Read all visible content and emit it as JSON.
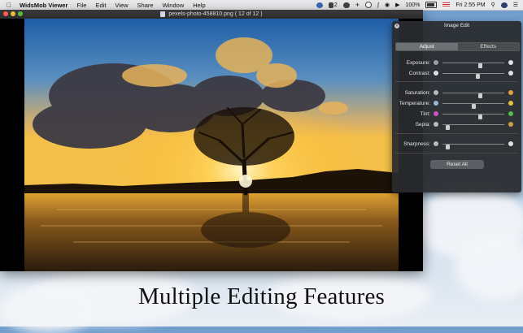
{
  "menubar": {
    "app_name": "WidsMob Viewer",
    "menus": [
      "File",
      "Edit",
      "View",
      "Share",
      "Window",
      "Help"
    ],
    "status_count": "2",
    "battery": "100%",
    "clock": "Fri 2:55 PM"
  },
  "viewer": {
    "window_title": "pexels-photo-458810.png ( 12 of 12 )"
  },
  "panel": {
    "title": "Image Edit",
    "tabs": [
      "Adjust",
      "Effects"
    ],
    "active_tab": "Adjust",
    "sliders": [
      {
        "label": "Exposure:",
        "value": 0.62,
        "left_icon_color": "#9aa0a6",
        "right_icon_color": "#e0e0e0"
      },
      {
        "label": "Contrast:",
        "value": 0.58,
        "left_icon_color": "#e0e0e0",
        "right_icon_color": "#e0e0e0"
      },
      {
        "label": "Saturation:",
        "value": 0.62,
        "left_icon_color": "#bbbbbb",
        "right_icon_color": "#e0a040"
      },
      {
        "label": "Temperature:",
        "value": 0.5,
        "left_icon_color": "#9ab8d8",
        "right_icon_color": "#e8c040"
      },
      {
        "label": "Tint:",
        "value": 0.62,
        "left_icon_color": "#d050c0",
        "right_icon_color": "#50c050"
      },
      {
        "label": "Sepia:",
        "value": 0.05,
        "left_icon_color": "#bbbbbb",
        "right_icon_color": "#d0a040"
      },
      {
        "label": "Sharpness:",
        "value": 0.05,
        "left_icon_color": "#bbbbbb",
        "right_icon_color": "#e0e0e0"
      }
    ],
    "reset_label": "Reset All"
  },
  "headline": "Multiple Editing Features",
  "colors": {
    "menubar_bg": "#e9e9eb",
    "panel_bg": "#2a2c30",
    "close_light": "#fc5b57",
    "minimize_light": "#e5bf3c",
    "zoom_light": "#57c038"
  }
}
